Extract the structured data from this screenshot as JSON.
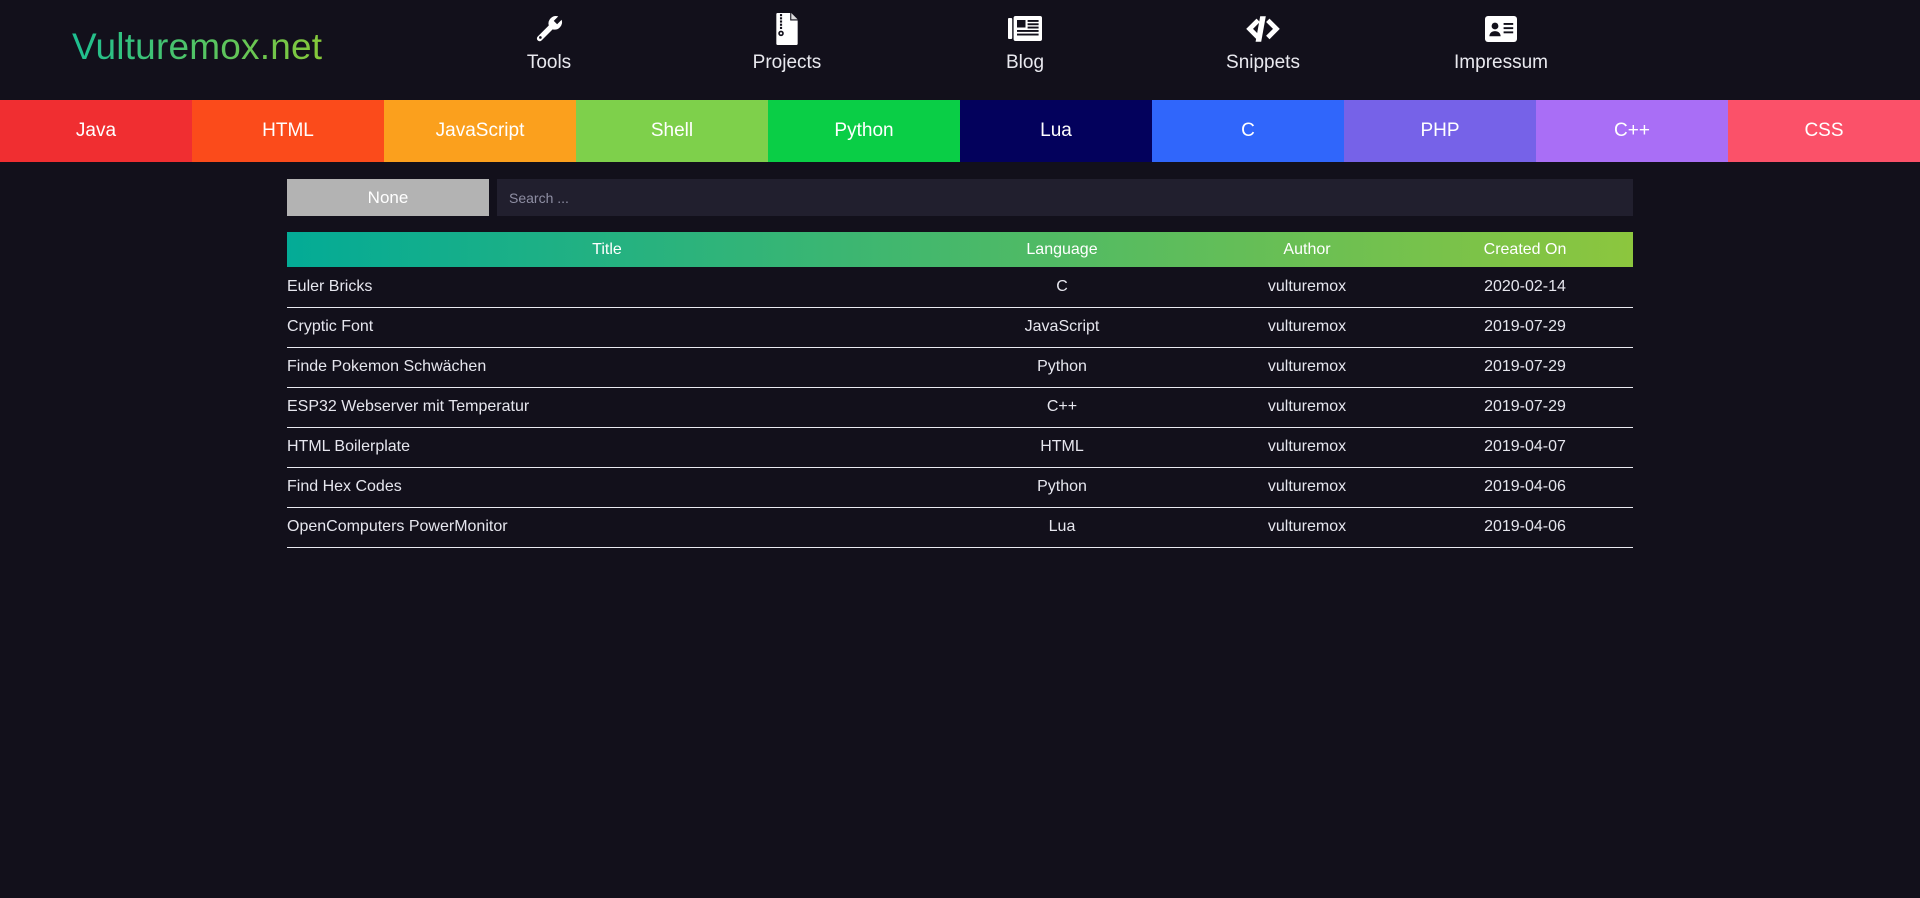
{
  "site": {
    "brand": "Vulturemox.net",
    "brand_gradient_from": "#1dbf91",
    "brand_gradient_to": "#86c83a",
    "background": "#12101b"
  },
  "nav": {
    "items": [
      {
        "label": "Tools",
        "icon": "wrench-icon"
      },
      {
        "label": "Projects",
        "icon": "file-archive-icon"
      },
      {
        "label": "Blog",
        "icon": "newspaper-icon"
      },
      {
        "label": "Snippets",
        "icon": "code-brackets-icon"
      },
      {
        "label": "Impressum",
        "icon": "id-card-icon"
      }
    ]
  },
  "language_tabs": [
    {
      "label": "Java",
      "color": "#f02e31"
    },
    {
      "label": "HTML",
      "color": "#fb4b1b"
    },
    {
      "label": "JavaScript",
      "color": "#fba01d"
    },
    {
      "label": "Shell",
      "color": "#7ed04b"
    },
    {
      "label": "Python",
      "color": "#0ace46"
    },
    {
      "label": "Lua",
      "color": "#03015c"
    },
    {
      "label": "C",
      "color": "#3066fb"
    },
    {
      "label": "PHP",
      "color": "#7662e8"
    },
    {
      "label": "C++",
      "color": "#a96ef6"
    },
    {
      "label": "CSS",
      "color": "#fb5169"
    }
  ],
  "filter": {
    "selected_label": "None",
    "search_value": "",
    "search_placeholder": "Search ..."
  },
  "table": {
    "header_gradient_from": "#03ab96",
    "header_gradient_to": "#8cc63e",
    "columns": [
      "Title",
      "Language",
      "Author",
      "Created On"
    ],
    "rows": [
      {
        "title": "Euler Bricks",
        "language": "C",
        "author": "vulturemox",
        "created": "2020-02-14"
      },
      {
        "title": "Cryptic Font",
        "language": "JavaScript",
        "author": "vulturemox",
        "created": "2019-07-29"
      },
      {
        "title": "Finde Pokemon Schwächen",
        "language": "Python",
        "author": "vulturemox",
        "created": "2019-07-29"
      },
      {
        "title": "ESP32 Webserver mit Temperatur",
        "language": "C++",
        "author": "vulturemox",
        "created": "2019-07-29"
      },
      {
        "title": "HTML Boilerplate",
        "language": "HTML",
        "author": "vulturemox",
        "created": "2019-04-07"
      },
      {
        "title": "Find Hex Codes",
        "language": "Python",
        "author": "vulturemox",
        "created": "2019-04-06"
      },
      {
        "title": "OpenComputers PowerMonitor",
        "language": "Lua",
        "author": "vulturemox",
        "created": "2019-04-06"
      }
    ]
  }
}
